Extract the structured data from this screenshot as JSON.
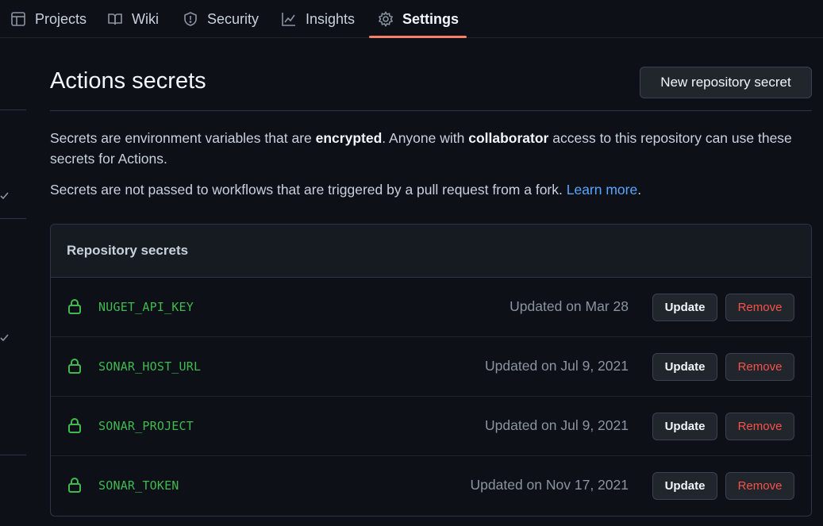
{
  "nav": {
    "tabs": [
      {
        "label": "Projects",
        "icon": "table-icon"
      },
      {
        "label": "Wiki",
        "icon": "book-icon"
      },
      {
        "label": "Security",
        "icon": "shield-icon"
      },
      {
        "label": "Insights",
        "icon": "graph-icon"
      },
      {
        "label": "Settings",
        "icon": "gear-icon",
        "active": true
      }
    ]
  },
  "page": {
    "title": "Actions secrets",
    "new_secret_label": "New repository secret",
    "desc1_a": "Secrets are environment variables that are ",
    "desc1_b": "encrypted",
    "desc1_c": ". Anyone with ",
    "desc1_d": "collaborator",
    "desc1_e": " access to this repository can use these secrets for Actions.",
    "desc2_a": "Secrets are not passed to workflows that are triggered by a pull request from a fork. ",
    "desc2_link": "Learn more",
    "desc2_end": "."
  },
  "secrets": {
    "header": "Repository secrets",
    "update_label": "Update",
    "remove_label": "Remove",
    "items": [
      {
        "name": "NUGET_API_KEY",
        "updated": "Updated on Mar 28"
      },
      {
        "name": "SONAR_HOST_URL",
        "updated": "Updated on Jul 9, 2021"
      },
      {
        "name": "SONAR_PROJECT",
        "updated": "Updated on Jul 9, 2021"
      },
      {
        "name": "SONAR_TOKEN",
        "updated": "Updated on Nov 17, 2021"
      }
    ]
  },
  "colors": {
    "accent_tab": "#f78166",
    "secret_green": "#3fb950",
    "remove_red": "#f85149",
    "link_blue": "#58a6ff"
  }
}
